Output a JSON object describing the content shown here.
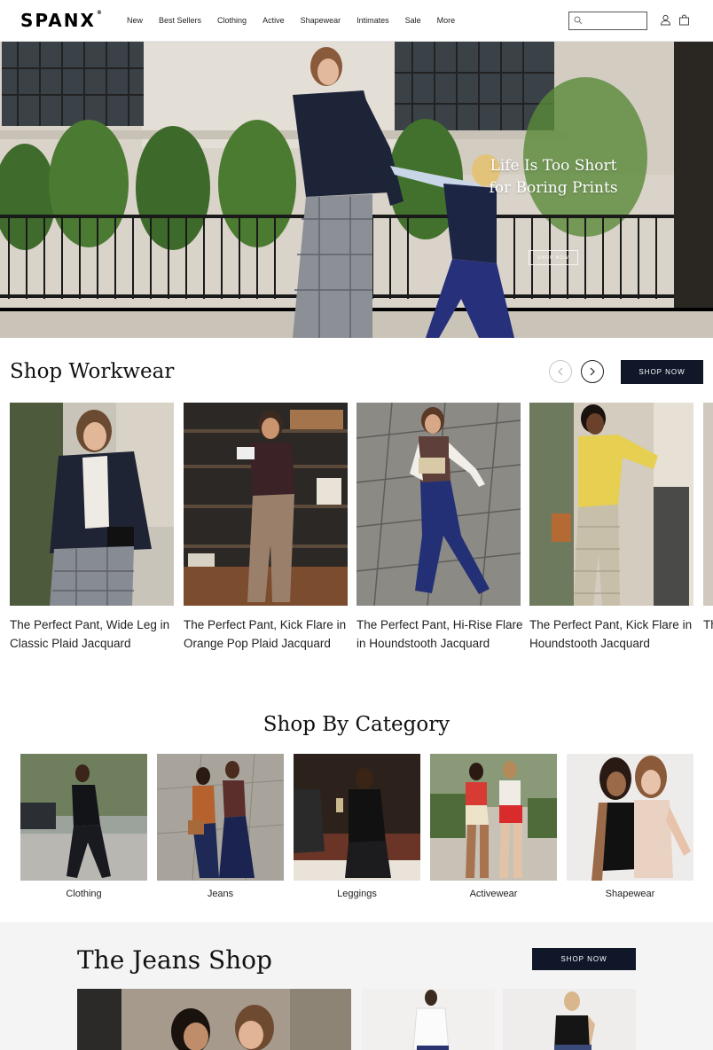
{
  "brand": {
    "name": "SPANX",
    "mark": "®"
  },
  "nav": {
    "items": [
      "New",
      "Best Sellers",
      "Clothing",
      "Active",
      "Shapewear",
      "Intimates",
      "Sale",
      "More"
    ]
  },
  "search": {
    "value": "",
    "placeholder": ""
  },
  "hero": {
    "line1": "Life Is Too Short",
    "line2": "for Boring Prints",
    "cta": "SHOP NOW"
  },
  "workwear": {
    "title": "Shop Workwear",
    "cta": "SHOP NOW",
    "products": [
      {
        "name": "The Perfect Pant, Wide Leg in Classic Plaid Jacquard"
      },
      {
        "name": "The Perfect Pant, Kick Flare in Orange Pop Plaid Jacquard"
      },
      {
        "name": "The Perfect Pant, Hi-Rise Flare in Houndstooth Jacquard"
      },
      {
        "name": "The Perfect Pant, Kick Flare in Houndstooth Jacquard"
      },
      {
        "name": "Th Cl"
      }
    ]
  },
  "categories": {
    "title": "Shop By Category",
    "items": [
      {
        "label": "Clothing"
      },
      {
        "label": "Jeans"
      },
      {
        "label": "Leggings"
      },
      {
        "label": "Activewear"
      },
      {
        "label": "Shapewear"
      }
    ]
  },
  "jeans_shop": {
    "title": "The Jeans Shop",
    "cta": "SHOP NOW"
  },
  "colors": {
    "accent": "#0f1729",
    "background_alt": "#f4f4f4"
  }
}
